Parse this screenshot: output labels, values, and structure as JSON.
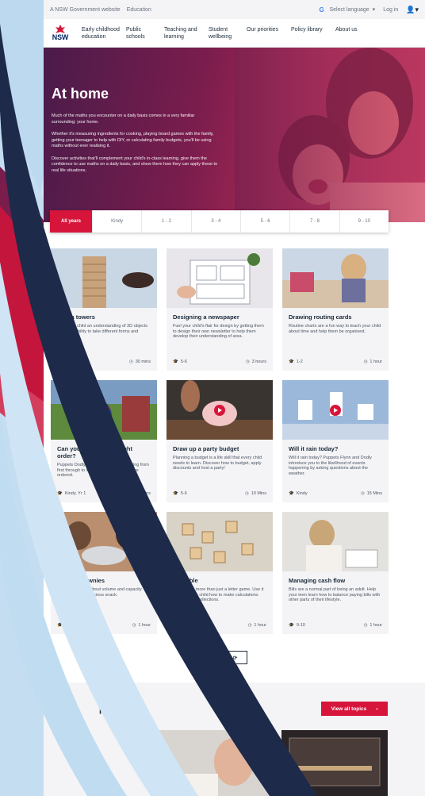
{
  "util": {
    "site_label": "A NSW Government website",
    "dept": "Education",
    "language": "Select language",
    "login": "Log in"
  },
  "brand": {
    "logo_text": "NSW",
    "logo_sub": "GOVERNMENT"
  },
  "nav": {
    "items": [
      "Early childhood education",
      "Public schools",
      "Teaching and learning",
      "Student wellbeing",
      "Our priorities",
      "Policy library",
      "About us"
    ]
  },
  "hero": {
    "title": "At home",
    "p1": "Much of the maths you encounter on a daily basis comes in a very familiar surrounding: your home.",
    "p2": "Whether it's measuring ingredients for cooking, playing board games with the family, getting your teenager to help with DIY, or calculating family budgets, you'll be using maths without ever realising it.",
    "p3": "Discover activities that'll complement your child's in-class learning, give them the confidence to use maths on a daily basis, and show them how they can apply these to real life situations."
  },
  "filters": [
    "All years",
    "Kindy",
    "1 - 2",
    "3 - 4",
    "5 - 6",
    "7 - 8",
    "9 - 10"
  ],
  "cards": [
    {
      "title": "Jenga towers",
      "desc": "Give your child an understanding of 3D objects and their ability to take different forms and shapes.",
      "years": "7-8",
      "time": "30 mins"
    },
    {
      "title": "Designing a newspaper",
      "desc": "Fuel your child's flair for design by getting them to design their own newsletter to help them develop their understanding of area.",
      "years": "5-6",
      "time": "3 hours"
    },
    {
      "title": "Drawing routing cards",
      "desc": "Routine charts are a fun way to teach your child about time and help them be organised.",
      "years": "1-2",
      "time": "1 hour"
    },
    {
      "title": "Can you work out the right order?",
      "desc": "Puppets Dodly and Flynn explore counting from first through to sixth and how numbers are ordered.",
      "years": "Kindy, Yr 1",
      "time": "15 mins"
    },
    {
      "title": "Draw up a party budget",
      "desc": "Planning a budget is a life skill that every child needs to learn. Discover how to budget, apply discounts and host a party!",
      "years": "5-6",
      "time": "10 Mins"
    },
    {
      "title": "Will it rain today?",
      "desc": "Will it rain today? Puppets Flynn and Dodly introduce you to the likelihood of events happening by asking questions about the weather.",
      "years": "Kindy",
      "time": "15 Mins"
    },
    {
      "title": "Baking brownies",
      "desc": "Teach your child about volume and capacity whilst baking a delicious snack.",
      "years": "3-4",
      "time": "1 hour"
    },
    {
      "title": "Scrabble",
      "desc": "Scrabble is more than just a letter game. Use it to teach your child how to make calculations and quantify collections.",
      "years": "5-6",
      "time": "1 hour"
    },
    {
      "title": "Managing cash flow",
      "desc": "Bills are a normal part of being an adult. Help your teen learn how to balance paying bills with other parts of their lifestyle.",
      "years": "9-10",
      "time": "1 hour"
    }
  ],
  "load_more": "Load More",
  "topics": {
    "title": "pics",
    "view_all": "View all topics",
    "tile2_label": "ture"
  },
  "colors": {
    "accent": "#d7153a",
    "navy": "#002664",
    "hero": "#7a1d4d"
  }
}
